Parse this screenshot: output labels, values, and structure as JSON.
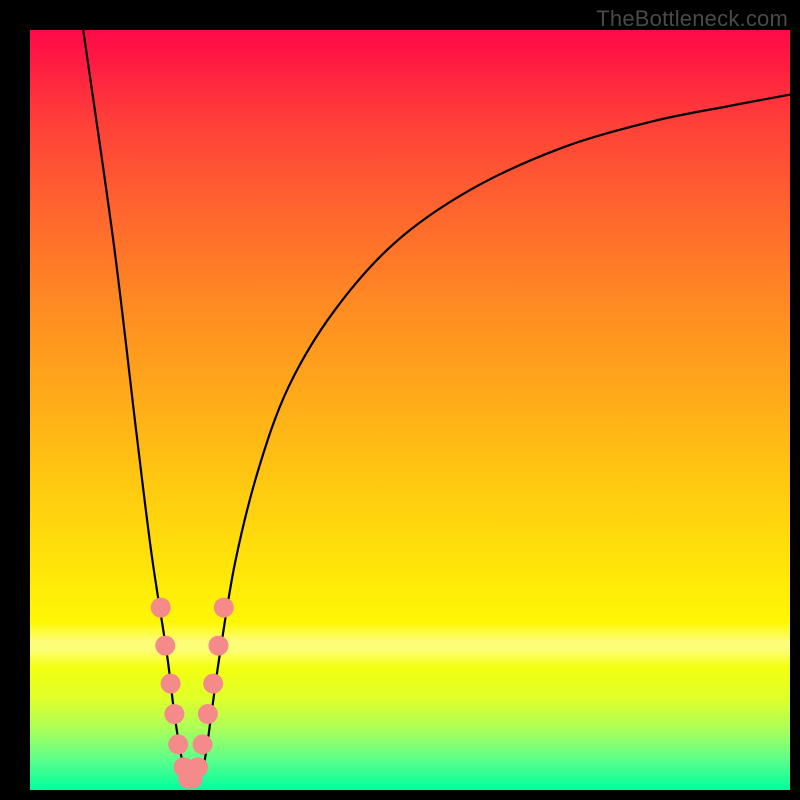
{
  "watermark": "TheBottleneck.com",
  "colors": {
    "frame": "#000000",
    "curve": "#000000",
    "marker_fill": "#f48a8a",
    "marker_stroke": "#e06a6a",
    "gradient_top": "#ff0a4a",
    "gradient_bottom": "#00ff9d"
  },
  "chart_data": {
    "type": "line",
    "title": "",
    "xlabel": "",
    "ylabel": "",
    "xlim": [
      0,
      100
    ],
    "ylim": [
      0,
      100
    ],
    "grid": false,
    "legend": false,
    "series": [
      {
        "name": "bottleneck-curve",
        "x": [
          7,
          11,
          14,
          16,
          18,
          19,
          20,
          21,
          22,
          23,
          24,
          25,
          27,
          30,
          34,
          40,
          48,
          58,
          70,
          82,
          92,
          100
        ],
        "y": [
          100,
          72,
          47,
          31,
          18,
          10,
          4,
          0.8,
          0.8,
          4,
          11,
          18,
          30,
          42,
          53,
          63,
          72,
          79,
          84.5,
          88,
          90,
          91.5
        ]
      }
    ],
    "markers": {
      "name": "highlight-points",
      "x": [
        17.2,
        17.8,
        18.5,
        19.0,
        19.5,
        20.2,
        20.8,
        21.4,
        22.1,
        22.7,
        23.4,
        24.1,
        24.8,
        25.5
      ],
      "y": [
        24,
        19,
        14,
        10,
        6,
        3,
        1.5,
        1.5,
        3,
        6,
        10,
        14,
        19,
        24
      ]
    }
  }
}
